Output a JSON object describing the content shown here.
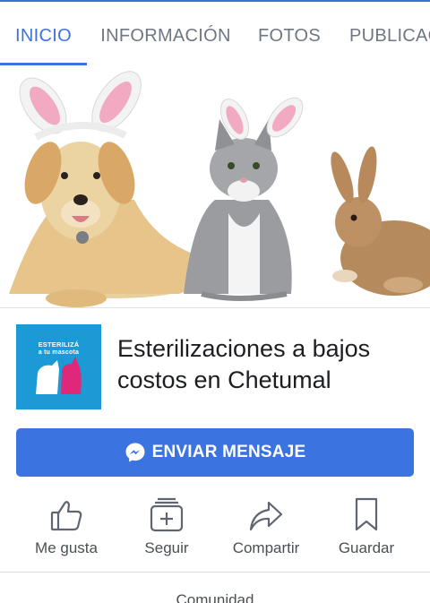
{
  "tabs": [
    {
      "label": "INICIO",
      "active": true
    },
    {
      "label": "INFORMACIÓN",
      "active": false
    },
    {
      "label": "FOTOS",
      "active": false
    },
    {
      "label": "PUBLICACIONES",
      "active": false
    }
  ],
  "page": {
    "name": "Esterilizaciones a bajos costos en Chetumal",
    "avatar": {
      "line1": "ESTERILIZÁ",
      "line2": "a tu mascota"
    }
  },
  "message_button": {
    "label": "ENVIAR MENSAJE",
    "icon": "messenger-icon"
  },
  "actions": [
    {
      "label": "Me gusta",
      "icon": "thumbs-up-icon"
    },
    {
      "label": "Seguir",
      "icon": "follow-icon"
    },
    {
      "label": "Compartir",
      "icon": "share-icon"
    },
    {
      "label": "Guardar",
      "icon": "bookmark-icon"
    }
  ],
  "section": {
    "community_label": "Comunidad"
  },
  "colors": {
    "accent": "#3b74e0",
    "avatar_bg": "#1b9ad6"
  }
}
